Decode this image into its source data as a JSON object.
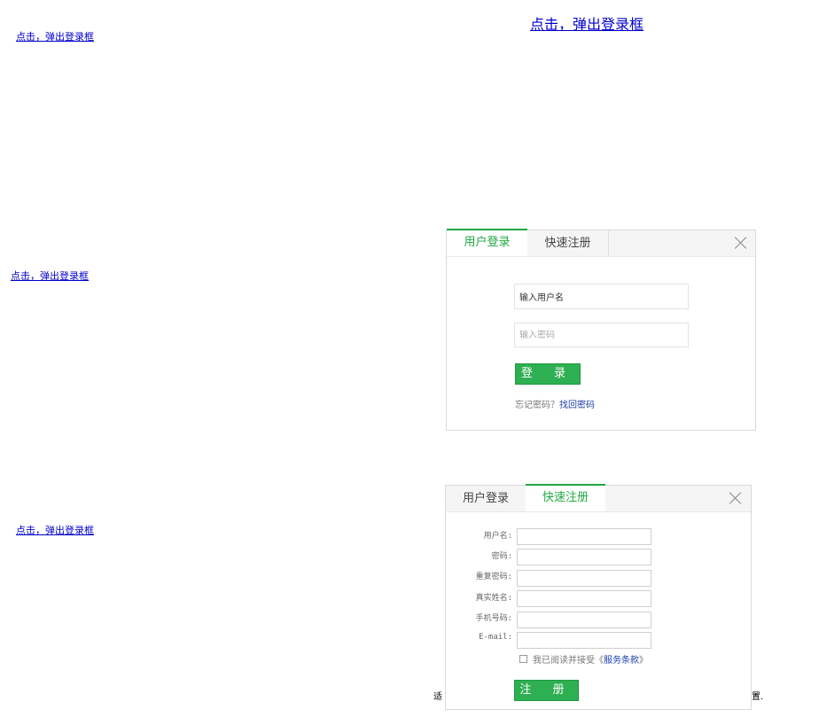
{
  "links": {
    "top_left": "点击，弹出登录框",
    "top_center": "点击，弹出登录框",
    "middle_left": "点击，弹出登录框",
    "bottom_left": "点击，弹出登录框"
  },
  "login_dialog": {
    "tab_login": "用户登录",
    "tab_register": "快速注册",
    "username_value": "输入用户名",
    "password_placeholder": "输入密码",
    "login_button": "登 录",
    "forgot_text": "忘记密码？",
    "find_password_link": "找回密码"
  },
  "register_dialog": {
    "tab_login": "用户登录",
    "tab_register": "快速注册",
    "fields": [
      {
        "label": "用户名:"
      },
      {
        "label": "密码:"
      },
      {
        "label": "重复密码:"
      },
      {
        "label": "真实姓名:"
      },
      {
        "label": "手机号码:"
      },
      {
        "label": "E-mail:"
      }
    ],
    "agree_text": "我已阅读并接受《",
    "terms_link": "服务条款",
    "agree_close": "》",
    "register_button": "注 册"
  },
  "background_fragments": {
    "left": "适",
    "right": "置."
  },
  "colors": {
    "accent_green": "#22a843",
    "button_green": "#2eaf52",
    "link_blue": "#0000cc"
  }
}
